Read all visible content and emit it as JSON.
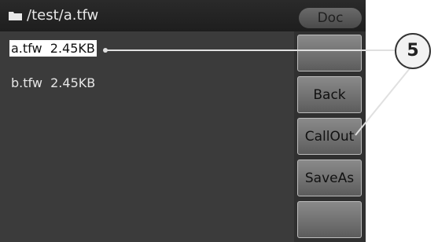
{
  "titlebar": {
    "path": "/test/a.tfw",
    "tab_label": "Doc",
    "folder_icon": "folder-icon"
  },
  "files": [
    {
      "name": "a.tfw",
      "size": "2.45KB",
      "selected": true
    },
    {
      "name": "b.tfw",
      "size": "2.45KB",
      "selected": false
    }
  ],
  "sidebar": {
    "buttons": [
      "",
      "Back",
      "CallOut",
      "SaveAs",
      ""
    ]
  },
  "callout": {
    "number": "5"
  },
  "colors": {
    "screen_bg": "#3a3a3a",
    "selection_bg": "#ffffff",
    "callout_line": "#e0e0e0"
  }
}
